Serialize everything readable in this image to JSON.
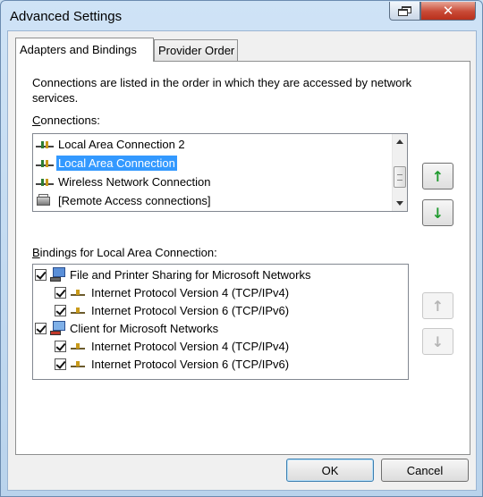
{
  "window": {
    "title": "Advanced Settings"
  },
  "tabs": [
    {
      "label": "Adapters and Bindings",
      "active": true
    },
    {
      "label": "Provider Order",
      "active": false
    }
  ],
  "description": "Connections are listed in the order in which they are accessed by network services.",
  "connections": {
    "label_accel": "C",
    "label_rest": "onnections:",
    "items": [
      {
        "label": "Local Area Connection 2",
        "icon": "network-adapter-icon",
        "selected": false
      },
      {
        "label": "Local Area Connection",
        "icon": "network-adapter-icon",
        "selected": true
      },
      {
        "label": "Wireless Network Connection",
        "icon": "network-adapter-icon",
        "selected": false
      },
      {
        "label": "[Remote Access connections]",
        "icon": "remote-access-icon",
        "selected": false
      }
    ],
    "move_up_icon": "arrow-up-icon",
    "move_down_icon": "arrow-down-icon"
  },
  "bindings": {
    "label_accel": "B",
    "label_rest": "indings for Local Area Connection:",
    "items": [
      {
        "label": "File and Printer Sharing for Microsoft Networks",
        "checked": true,
        "icon": "file-printer-sharing-icon",
        "children": [
          {
            "label": "Internet Protocol Version 4 (TCP/IPv4)",
            "checked": true,
            "icon": "protocol-icon"
          },
          {
            "label": "Internet Protocol Version 6 (TCP/IPv6)",
            "checked": true,
            "icon": "protocol-icon"
          }
        ]
      },
      {
        "label": "Client for Microsoft Networks",
        "checked": true,
        "icon": "network-client-icon",
        "children": [
          {
            "label": "Internet Protocol Version 4 (TCP/IPv4)",
            "checked": true,
            "icon": "protocol-icon"
          },
          {
            "label": "Internet Protocol Version 6 (TCP/IPv6)",
            "checked": true,
            "icon": "protocol-icon"
          }
        ]
      }
    ]
  },
  "buttons": {
    "ok": "OK",
    "cancel": "Cancel"
  },
  "colors": {
    "selection": "#3399ff",
    "arrow_enabled": "#1f9a2e",
    "arrow_disabled": "#b5b5b5"
  }
}
